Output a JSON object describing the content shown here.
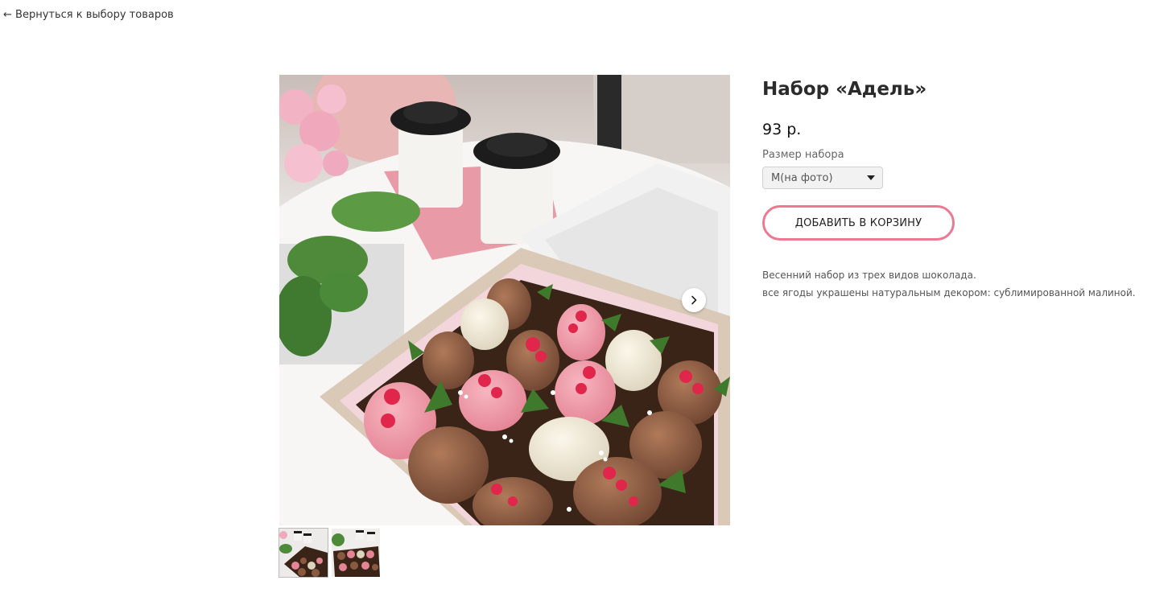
{
  "nav": {
    "back_label": "← Вернуться к выбору товаров"
  },
  "product": {
    "title": "Набор «Адель»",
    "price": "93 р.",
    "option_label": "Размер набора",
    "selected_option": "M(на фото)",
    "add_to_cart_label": "ДОБАВИТЬ В КОРЗИНУ",
    "description_lines": [
      "Весенний набор из трех видов шоколада.",
      "все ягоды украшены натуральным декором: сублимированной малиной."
    ]
  },
  "gallery": {
    "image_alt": "chocolate-covered strawberries box",
    "thumbnail_count": 2,
    "active_thumbnail": 1
  },
  "colors": {
    "accent": "#ee7891",
    "title": "#2b2b2b",
    "text_muted": "#555555"
  },
  "icons": {
    "next": "chevron-right-icon"
  }
}
